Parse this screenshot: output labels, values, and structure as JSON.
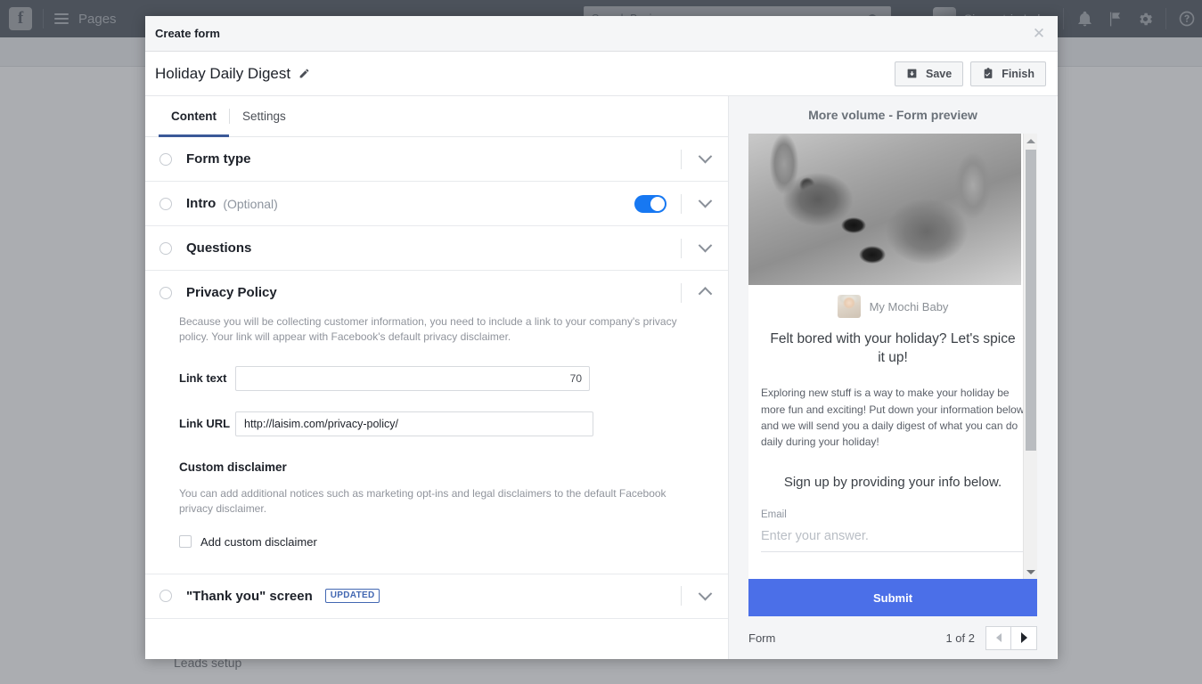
{
  "topbar": {
    "brand_icon": "facebook-logo-icon",
    "menu_icon": "hamburger-menu-icon",
    "section_label": "Pages",
    "search_placeholder": "Search Business",
    "search_icon": "search-icon",
    "account_name": "Simmetriq Labs",
    "notifications_icon": "bell-icon",
    "flag_icon": "flag-icon",
    "settings_icon": "gear-icon",
    "help_icon": "help-circle-icon"
  },
  "background": {
    "leads_setup_label": "Leads setup"
  },
  "modal": {
    "header_title": "Create form",
    "close_icon": "close-icon",
    "form_name": "Holiday Daily Digest",
    "edit_icon": "pencil-icon",
    "save_label": "Save",
    "save_icon": "save-icon",
    "finish_label": "Finish",
    "finish_icon": "finish-checklist-icon",
    "tabs": [
      {
        "label": "Content",
        "active": true
      },
      {
        "label": "Settings",
        "active": false
      }
    ],
    "sections": [
      {
        "title": "Form type",
        "optional": "",
        "expanded": false,
        "toggle": null,
        "badge": ""
      },
      {
        "title": "Intro",
        "optional": "(Optional)",
        "expanded": false,
        "toggle": "on",
        "badge": ""
      },
      {
        "title": "Questions",
        "optional": "",
        "expanded": false,
        "toggle": null,
        "badge": ""
      },
      {
        "title": "Privacy Policy",
        "optional": "",
        "expanded": true,
        "toggle": null,
        "badge": ""
      },
      {
        "title": "\"Thank you\" screen",
        "optional": "",
        "expanded": false,
        "toggle": null,
        "badge": "UPDATED"
      }
    ],
    "privacy_policy": {
      "help_text": "Because you will be collecting customer information, you need to include a link to your company's privacy policy. Your link will appear with Facebook's default privacy disclaimer.",
      "link_text_label": "Link text",
      "link_text_value": "",
      "link_text_counter": "70",
      "link_url_label": "Link URL",
      "link_url_value": "http://laisim.com/privacy-policy/",
      "custom_disclaimer_heading": "Custom disclaimer",
      "custom_disclaimer_text": "You can add additional notices such as marketing opt-ins and legal disclaimers to the default Facebook privacy disclaimer.",
      "add_custom_disclaimer_label": "Add custom disclaimer",
      "add_custom_disclaimer_checked": false
    }
  },
  "preview": {
    "title": "More volume - Form preview",
    "hero_image": "deer-pair-photo",
    "brand_avatar": "page-avatar",
    "brand_name": "My Mochi Baby",
    "headline": "Felt bored with your holiday? Let's spice it up!",
    "paragraph": "Exploring new stuff is a way to make your holiday be more fun and exciting! Put down your information below and we will send you a daily digest of what you can do daily during your holiday!",
    "subheading": "Sign up by providing your info below.",
    "field_label": "Email",
    "field_placeholder": "Enter your answer.",
    "submit_label": "Submit",
    "footer_label": "Form",
    "page_count": "1 of 2",
    "prev_icon": "triangle-left-icon",
    "next_icon": "triangle-right-icon",
    "scroll_up_icon": "triangle-up-icon",
    "scroll_down_icon": "triangle-down-icon"
  },
  "colors": {
    "accent_blue": "#1778f2",
    "tab_underline": "#3b5998",
    "submit_blue": "#4b6fe8",
    "badge_blue": "#4267b2",
    "topbar_dark": "#1d2733"
  }
}
